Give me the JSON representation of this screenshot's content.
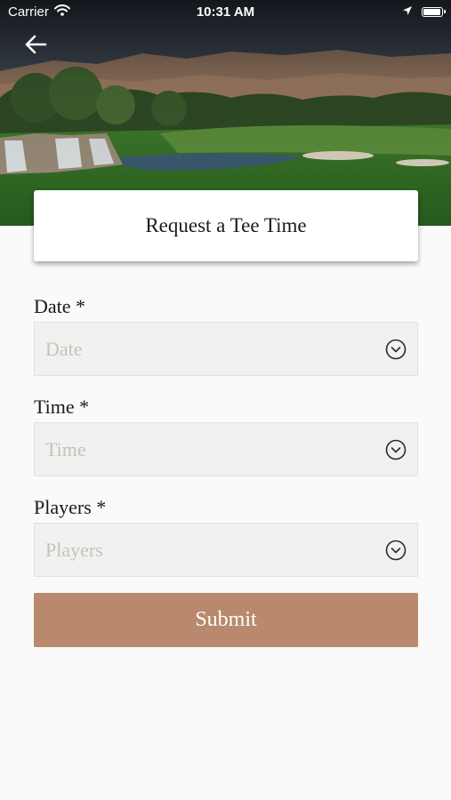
{
  "status_bar": {
    "carrier": "Carrier",
    "time": "10:31 AM",
    "battery_level": 1.0
  },
  "header": {
    "title": "Request a Tee Time",
    "back_icon": "arrow-left-icon"
  },
  "form": {
    "fields": [
      {
        "label": "Date *",
        "placeholder": "Date",
        "icon": "chevron-down-circle-icon"
      },
      {
        "label": "Time *",
        "placeholder": "Time",
        "icon": "chevron-down-circle-icon"
      },
      {
        "label": "Players *",
        "placeholder": "Players",
        "icon": "chevron-down-circle-icon"
      }
    ],
    "submit_label": "Submit"
  },
  "colors": {
    "submit_bg": "#b8896c",
    "field_bg": "#f2f1ef",
    "page_bg": "#fafafa"
  }
}
